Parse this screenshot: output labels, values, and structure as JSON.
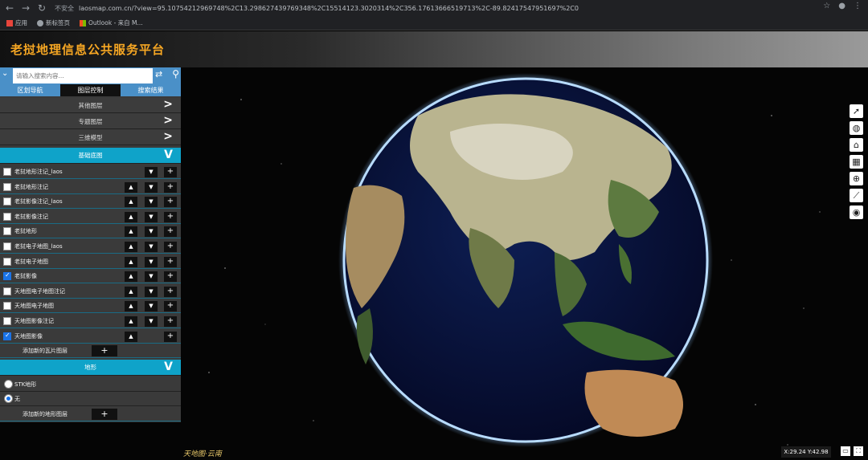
{
  "browser": {
    "security_label": "不安全",
    "url": "laosmap.com.cn/?view=95.10754212969748%2C13.298627439769348%2C15514123.3020314%2C356.17613666519713%2C-89.82417547951697%2C0",
    "bookmarks": [
      "应用",
      "新标签页",
      "Outlook - 来自 M..."
    ]
  },
  "app": {
    "title": "老挝地理信息公共服务平台"
  },
  "search": {
    "placeholder": "请输入搜索内容..."
  },
  "tabs": [
    {
      "label": "区划导航",
      "active": false
    },
    {
      "label": "图层控制",
      "active": true
    },
    {
      "label": "搜索结果",
      "active": false
    }
  ],
  "sections": {
    "other_layers": "其他图层",
    "thematic_layers": "专题图层",
    "models_3d": "三维模型",
    "base_map": "基础底图",
    "terrain": "地形"
  },
  "layers": [
    {
      "label": "老挝地形注记_laos",
      "checked": false,
      "up": false
    },
    {
      "label": "老挝地形注记",
      "checked": false,
      "up": true
    },
    {
      "label": "老挝影像注记_laos",
      "checked": false,
      "up": true
    },
    {
      "label": "老挝影像注记",
      "checked": false,
      "up": true
    },
    {
      "label": "老挝地形",
      "checked": false,
      "up": true
    },
    {
      "label": "老挝电子地图_laos",
      "checked": false,
      "up": true
    },
    {
      "label": "老挝电子地图",
      "checked": false,
      "up": true
    },
    {
      "label": "老挝影像",
      "checked": true,
      "up": true
    },
    {
      "label": "天地图电子地图注记",
      "checked": false,
      "up": true
    },
    {
      "label": "天地图电子地图",
      "checked": false,
      "up": true
    },
    {
      "label": "天地图影像注记",
      "checked": false,
      "up": true
    },
    {
      "label": "天地图影像",
      "checked": true,
      "up": true,
      "down": false
    }
  ],
  "add_tile_layer": "添加新的瓦片图层",
  "terrain_options": [
    {
      "label": "STK地形",
      "selected": false
    },
    {
      "label": "无",
      "selected": true
    }
  ],
  "add_terrain_layer": "添加新的地形图层",
  "coords": "X:29.24 Y:42.98",
  "logo_text": "天地图·云南",
  "icons": {
    "up": "▲",
    "down": "▼",
    "plus": "+",
    "expand": ">",
    "collapse": "V"
  }
}
